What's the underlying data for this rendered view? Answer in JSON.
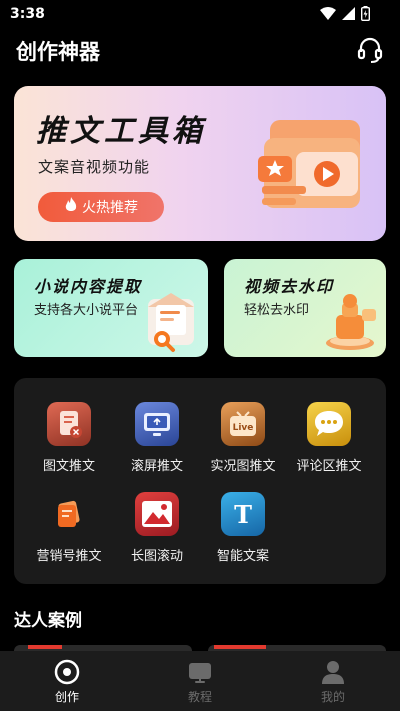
{
  "status": {
    "time": "3:38"
  },
  "header": {
    "title": "创作神器",
    "support_icon": "headset-icon"
  },
  "hero": {
    "title": "推文工具箱",
    "subtitle": "文案音视频功能",
    "button_label": "火热推荐"
  },
  "cards": [
    {
      "title": "小说内容提取",
      "subtitle": "支持各大小说平台"
    },
    {
      "title": "视频去水印",
      "subtitle": "轻松去水印"
    }
  ],
  "tools": [
    {
      "label": "图文推文",
      "icon": "image-text-icon",
      "color": "#b9503f"
    },
    {
      "label": "滚屏推文",
      "icon": "scroll-screen-icon",
      "color": "#3b5fb8"
    },
    {
      "label": "实况图推文",
      "icon": "live-photo-icon",
      "color": "#c9792c"
    },
    {
      "label": "评论区推文",
      "icon": "comment-icon",
      "color": "#e7b81d"
    },
    {
      "label": "营销号推文",
      "icon": "marketing-icon",
      "color": "#e8642a"
    },
    {
      "label": "长图滚动",
      "icon": "long-image-icon",
      "color": "#c7282f"
    },
    {
      "label": "智能文案",
      "icon": "smart-text-icon",
      "color": "#2189c9"
    }
  ],
  "section": {
    "title": "达人案例"
  },
  "tabbar": {
    "items": [
      {
        "label": "创作",
        "icon": "create-icon",
        "active": true
      },
      {
        "label": "教程",
        "icon": "tutorial-icon",
        "active": false
      },
      {
        "label": "我的",
        "icon": "profile-icon",
        "active": false
      }
    ]
  }
}
